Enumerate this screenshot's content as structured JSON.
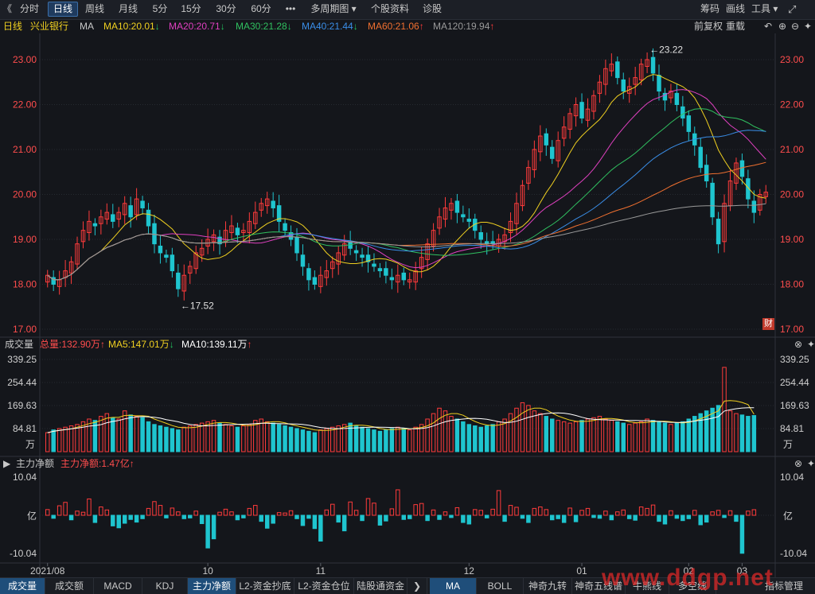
{
  "toolbar": {
    "back": "《",
    "tabs": [
      "分时",
      "日线",
      "周线",
      "月线",
      "5分",
      "15分",
      "30分",
      "60分",
      "•••",
      "多周期图 ▾",
      "个股资料",
      "诊股"
    ],
    "active_tab": "日线",
    "right": [
      "筹码",
      "画线",
      "工具 ▾"
    ],
    "expand_icon": "expand-icon"
  },
  "ma_bar": {
    "period": "日线",
    "stock": "兴业银行",
    "ma": "MA",
    "items": [
      {
        "text": "MA10:20.01",
        "arrow": "↓",
        "color": "#f0d020",
        "arrow_color": "#22c55e"
      },
      {
        "text": "MA20:20.71",
        "arrow": "↓",
        "color": "#e040c0",
        "arrow_color": "#22c55e"
      },
      {
        "text": "MA30:21.28",
        "arrow": "↓",
        "color": "#30c060",
        "arrow_color": "#22c55e"
      },
      {
        "text": "MA40:21.44",
        "arrow": "↓",
        "color": "#3a8ee8",
        "arrow_color": "#22c55e"
      },
      {
        "text": "MA60:21.06",
        "arrow": "↑",
        "color": "#f07030",
        "arrow_color": "#ff3b3b"
      },
      {
        "text": "MA120:19.94",
        "arrow": "↑",
        "color": "#9a9a9a",
        "arrow_color": "#ff3b3b"
      }
    ],
    "right": [
      "前复权",
      "重载"
    ]
  },
  "price_axis": {
    "ticks": [
      "23.00",
      "22.00",
      "21.00",
      "20.00",
      "19.00",
      "18.00",
      "17.00"
    ],
    "min": 17.0,
    "max": 23.0
  },
  "annotations": {
    "high": "←23.22",
    "low": "←17.52",
    "cai": "财"
  },
  "volume_panel": {
    "title": "成交量",
    "total": "总量:132.90万",
    "total_arrow": "↑",
    "ma5": "MA5:147.01万",
    "ma5_arrow": "↓",
    "ma10": "MA10:139.11万",
    "ma10_arrow": "↑",
    "ticks": [
      "339.25",
      "254.44",
      "169.63",
      "84.81"
    ],
    "unit": "万"
  },
  "flow_panel": {
    "title": "主力净额",
    "value": "主力净额:1.47亿",
    "value_arrow": "↑",
    "ticks": [
      "10.04",
      "亿",
      "-10.04"
    ]
  },
  "x_axis": {
    "labels": [
      "2021/08",
      "10",
      "11",
      "12",
      "01",
      "02",
      "03"
    ]
  },
  "bottom_tabs": {
    "left": [
      "成交量",
      "成交额",
      "MACD",
      "KDJ",
      "主力净额",
      "L2-资金抄底",
      "L2-资金仓位",
      "陆股通资金"
    ],
    "right": [
      "MA",
      "BOLL",
      "神奇九转",
      "神奇五线谱",
      "牛熊线",
      "多空线",
      "指标管理"
    ],
    "active_left": "主力净额",
    "active_right": "MA"
  },
  "watermark": "www.ddgp.net",
  "chart_data": {
    "type": "candlestick",
    "title": "",
    "stock": "兴业银行",
    "ylim": [
      17.0,
      23.0
    ],
    "high_label": 23.22,
    "low_label": 17.52,
    "colors": {
      "up": "#ff3b3b",
      "down": "#1fc5cf",
      "ma5": "#f0d020",
      "ma10": "#ffffff"
    },
    "closes": [
      18.2,
      18.0,
      18.1,
      18.3,
      18.5,
      18.9,
      19.2,
      19.4,
      19.3,
      19.5,
      19.6,
      19.4,
      19.6,
      19.8,
      19.5,
      19.9,
      19.7,
      19.3,
      18.9,
      18.7,
      18.6,
      18.3,
      17.9,
      18.2,
      18.4,
      18.7,
      18.8,
      19.0,
      19.1,
      18.9,
      19.2,
      19.3,
      19.1,
      19.2,
      19.4,
      19.6,
      19.8,
      19.9,
      19.7,
      19.4,
      19.2,
      19.0,
      18.7,
      18.4,
      18.1,
      18.0,
      18.2,
      18.3,
      18.5,
      18.7,
      18.9,
      18.8,
      18.7,
      18.6,
      18.5,
      18.4,
      18.3,
      18.2,
      18.1,
      18.2,
      18.1,
      18.1,
      18.3,
      18.6,
      18.9,
      19.2,
      19.5,
      19.7,
      19.8,
      19.6,
      19.5,
      19.4,
      19.2,
      19.0,
      18.9,
      18.9,
      19.0,
      19.1,
      19.4,
      19.8,
      20.2,
      20.6,
      21.0,
      21.3,
      21.1,
      20.8,
      21.2,
      21.5,
      21.8,
      22.0,
      21.7,
      21.9,
      22.2,
      22.5,
      22.8,
      22.9,
      22.6,
      22.3,
      22.4,
      22.6,
      22.9,
      23.0,
      22.7,
      22.3,
      22.1,
      22.3,
      22.0,
      21.7,
      21.4,
      21.1,
      20.6,
      20.3,
      19.5,
      18.9,
      19.8,
      20.3,
      20.7,
      20.4,
      19.9,
      19.6,
      20.0,
      20.05
    ],
    "volume": {
      "ylim": [
        0,
        339.25
      ],
      "unit": "万",
      "total": 132.9,
      "ma5": 147.01,
      "ma10": 139.11,
      "values": [
        70,
        80,
        85,
        90,
        95,
        100,
        110,
        120,
        115,
        130,
        140,
        125,
        120,
        150,
        135,
        130,
        125,
        110,
        100,
        95,
        90,
        85,
        80,
        90,
        95,
        100,
        105,
        110,
        115,
        105,
        100,
        95,
        90,
        95,
        100,
        115,
        120,
        110,
        105,
        100,
        95,
        90,
        85,
        80,
        75,
        70,
        80,
        85,
        90,
        95,
        100,
        105,
        95,
        90,
        85,
        80,
        75,
        80,
        85,
        90,
        85,
        80,
        90,
        100,
        120,
        140,
        160,
        150,
        130,
        120,
        110,
        100,
        95,
        90,
        95,
        100,
        110,
        120,
        140,
        160,
        180,
        170,
        150,
        140,
        130,
        120,
        115,
        110,
        105,
        110,
        115,
        120,
        125,
        130,
        120,
        115,
        110,
        105,
        100,
        105,
        110,
        120,
        115,
        110,
        105,
        100,
        105,
        110,
        120,
        130,
        140,
        150,
        160,
        170,
        310,
        150,
        140,
        135,
        130,
        132.9
      ]
    },
    "main_flow": {
      "ylim": [
        -10.04,
        10.04
      ],
      "unit": "亿",
      "latest": 1.47,
      "values": [
        1.5,
        -0.8,
        2.5,
        3.4,
        -1.2,
        1.1,
        0.8,
        4.3,
        -1.9,
        2.2,
        1.4,
        -2.8,
        -3.3,
        -2.1,
        -1.1,
        -1.8,
        -0.9,
        1.8,
        3.6,
        2.6,
        -0.7,
        1.9,
        0.9,
        -0.9,
        -0.7,
        1.1,
        -2.2,
        -8.6,
        -6.2,
        0.8,
        1.6,
        0.9,
        -1.2,
        -0.7,
        1.8,
        2.6,
        -1.6,
        -3.4,
        -2.1,
        0.7,
        0.6,
        1.2,
        -0.9,
        -2.7,
        -0.8,
        -3.5,
        -6.8,
        1.4,
        2.9,
        -1.8,
        -4.1,
        3.5,
        1.3,
        -1.4,
        4.4,
        3.2,
        -2.6,
        -1.5,
        1.7,
        6.7,
        -1.1,
        -0.9,
        2.8,
        3.1,
        -1.4,
        1.4,
        -1.1,
        0.9,
        -0.6,
        2.0,
        -1.9,
        -2.3,
        1.5,
        1.3,
        -0.7,
        1.6,
        6.5,
        -1.6,
        2.6,
        2.1,
        -0.8,
        -1.9,
        1.8,
        2.2,
        1.5,
        -1.2,
        -0.9,
        -1.9,
        1.9,
        -1.7,
        1.3,
        1.8,
        -0.6,
        -0.8,
        1.1,
        -1.2,
        0.9,
        1.4,
        -0.9,
        -1.3,
        2.2,
        1.8,
        2.7,
        -1.6,
        -2.3,
        1.2,
        -0.8,
        -1.4,
        -0.9,
        1.3,
        -2.5,
        -1.8,
        0.9,
        1.3,
        -0.6,
        1.2,
        -1.6,
        -10.0,
        1.1,
        1.47
      ]
    }
  }
}
